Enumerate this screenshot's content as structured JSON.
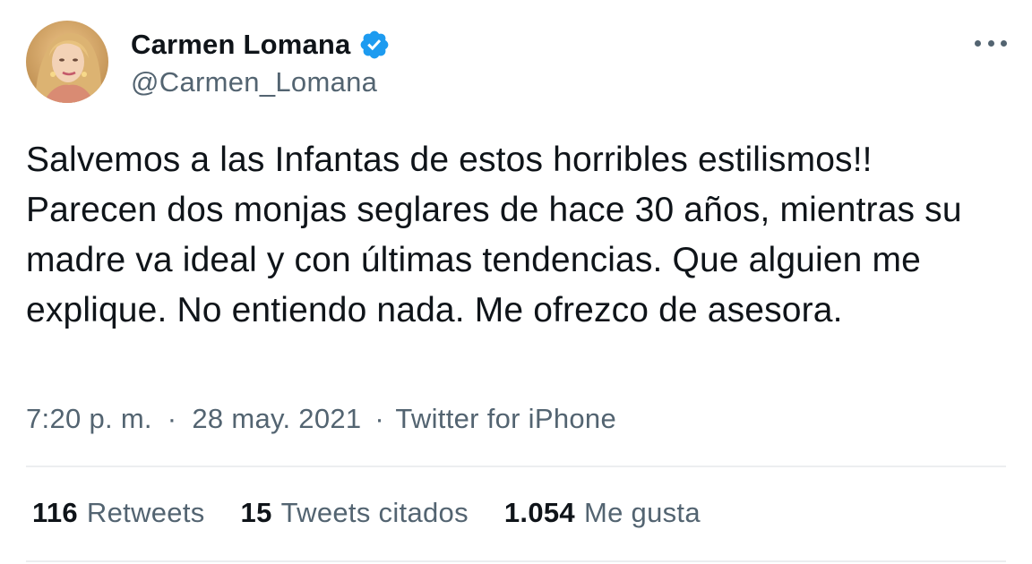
{
  "author": {
    "display_name": "Carmen Lomana",
    "handle": "@Carmen_Lomana",
    "verified_icon": "verified-badge-icon",
    "accent_color": "#1d9bf0"
  },
  "tweet": {
    "text": "Salvemos a las Infantas de estos horribles estilismos!! Parecen dos monjas seglares de hace 30 años, mientras su madre va ideal y con últimas tendencias. Que alguien me explique. No entiendo nada. Me ofrezco de asesora.",
    "time": "7:20 p. m.",
    "date": "28 may. 2021",
    "separator": "·",
    "source": "Twitter for iPhone"
  },
  "stats": [
    {
      "count": "116",
      "label": "Retweets"
    },
    {
      "count": "15",
      "label": "Tweets citados"
    },
    {
      "count": "1.054",
      "label": "Me gusta"
    }
  ],
  "more_menu_icon": "more-horizontal-icon"
}
